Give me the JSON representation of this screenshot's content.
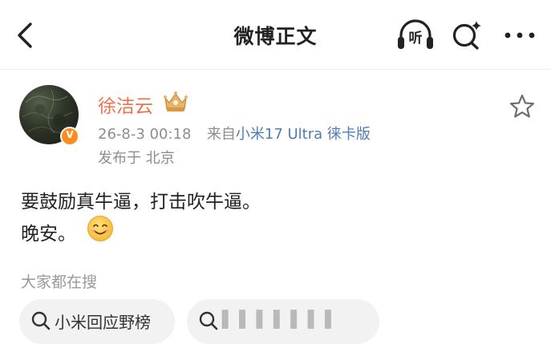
{
  "nav": {
    "title": "微博正文",
    "listen_label": "听",
    "icons": {
      "back": "chevron-left-icon",
      "listen": "headphones-icon",
      "search": "search-sparkle-icon",
      "more": "more-dots-icon"
    }
  },
  "post": {
    "author": "徐洁云",
    "avatar_icon": "avatar-image",
    "verified_mark": "V",
    "member_badge_icon": "crown-badge-icon",
    "timestamp": "26-8-3 00:18",
    "source_prefix": "来自",
    "source_device": "小米17 Ultra 徕卡版",
    "location": "发布于 北京",
    "favorite_icon": "star-outline-icon",
    "content_line1": "要鼓励真牛逼，打击吹牛逼。",
    "content_line2": "晚安。",
    "emoji_icon": "smiling-face-emoji"
  },
  "hot_search": {
    "title": "大家都在搜",
    "chips": [
      {
        "label": "小米回应野榜"
      },
      {
        "label": "▌▌▌▌▌▌▌"
      }
    ]
  },
  "colors": {
    "username": "#eb7350",
    "link": "#4f7db3",
    "meta": "#8d8d8d",
    "verified": "#ff8a1f",
    "chip_bg": "#f2f2f2"
  }
}
